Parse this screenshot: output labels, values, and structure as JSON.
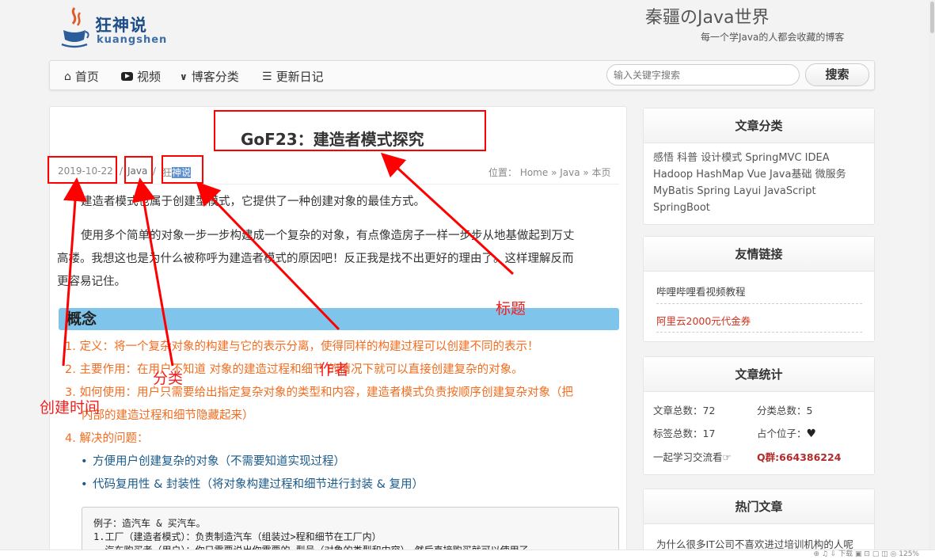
{
  "site": {
    "logo_cn": "狂神说",
    "logo_en": "kuangshen",
    "title": "秦疆のJava世界",
    "subtitle": "每一个学Java的人都会收藏的博客"
  },
  "nav": {
    "items": [
      {
        "icon": "home-icon",
        "label": "首页"
      },
      {
        "icon": "video-icon",
        "label": "视频"
      },
      {
        "icon": "chevron-down-icon",
        "label": "博客分类"
      },
      {
        "icon": "list-icon",
        "label": "更新日记"
      }
    ],
    "search_placeholder": "输入关键字搜索",
    "search_button": "搜索"
  },
  "article": {
    "title": "GoF23：建造者模式探究",
    "date": "2019-10-22",
    "sep1": "/",
    "category": "Java",
    "sep2": "/",
    "author_prefix": "狂",
    "author_highlight": "神说",
    "breadcrumb": "位置：  Home » Java » 本页",
    "paragraphs": [
      "建造者模式也属于创建型模式，它提供了一种创建对象的最佳方式。",
      "使用多个简单的对象一步一步构建成一个复杂的对象，有点像造房子一样一步步从地基做起到万丈",
      "高楼。我想这也是为什么被称呼为建造者模式的原因吧！反正我是找不出更好的理由了。这样理解反而",
      "更容易记住。"
    ],
    "concept_heading": "概念",
    "ordered": [
      "1. 定义：将一个复杂对象的构建与它的表示分离，使得同样的构建过程可以创建不同的表示！",
      "2. 主要作用：在用户不知道 对象的建造过程和细节 的情况下就可以直接创建复杂的对象。",
      "3. 如何使用：用户只需要给出指定复杂对象的类型和内容，建造者模式负责按顺序创建复杂对象（把",
      "内部的建造过程和细节隐藏起来）",
      "4. 解决的问题："
    ],
    "bullets": [
      "方便用户创建复杂的对象（不需要知道实现过程）",
      "代码复用性 & 封装性（将对象构建过程和细节进行封装 & 复用）"
    ],
    "code": "例子：造汽车 & 买汽车。\n1.工厂（建造者模式）：负责制造汽车（组装过>程和细节在工厂内）\n  汽车购买者（用户）：你只需要说出你需要的 型号（对象的类型和内容），然后直接购买就可以使用了"
  },
  "sidebar": {
    "categories": {
      "title": "文章分类",
      "tags": "感悟 科普 设计模式 SpringMVC IDEA Hadoop HashMap Vue Java基础 微服务 MyBatis Spring Layui JavaScript SpringBoot"
    },
    "links": {
      "title": "友情链接",
      "items": [
        "哔哩哔哩看视频教程",
        "阿里云2000元代金券"
      ]
    },
    "stats": {
      "title": "文章统计",
      "total_articles": "文章总数：72",
      "total_categories": "分类总数：5",
      "total_tags": "标签总数：17",
      "placeholder": "占个位子：",
      "study_group": "一起学习交流看☞",
      "qq_group": "Q群:664386224"
    },
    "hot": {
      "title": "热门文章",
      "first": "为什么很多IT公司不喜欢进过培训机构的人呢"
    }
  },
  "annotations": {
    "title": "标题",
    "category": "分类",
    "author": "作者",
    "created": "创建时间"
  },
  "statusbar": "⊕  ♫  ⇩ 下载  ▣  ⊡  ▢  ◫  ◎  125%",
  "colors": {
    "annotation_red": "#ff0000",
    "ordered_orange": "#f26c1f",
    "bullet_blue": "#1a5a8a",
    "concept_bar": "#7fc4ea",
    "qq_red": "#b22b2b"
  }
}
